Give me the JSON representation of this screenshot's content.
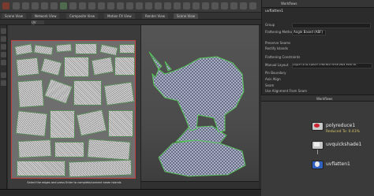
{
  "window_title": "Workflows",
  "tabs": [
    {
      "label": "Scene View"
    },
    {
      "label": "Network View"
    },
    {
      "label": "Composite View"
    },
    {
      "label": "Motion FX View"
    },
    {
      "label": "Render View"
    },
    {
      "label": "Scene View"
    }
  ],
  "uv_view": {
    "title": "UV View",
    "hint": "Select the edges and press Enter to complete/connect seam islands"
  },
  "right_panel": {
    "header": "Workflows",
    "node_title": "uvflatten1",
    "rows": [
      {
        "label": "Group"
      },
      {
        "label": "Flattening Method",
        "value": "Angle Based (ABF)"
      },
      {
        "label": "Preserve Seams"
      },
      {
        "label": "Rectify Islands"
      },
      {
        "label": "Flattening Constraints"
      },
      {
        "label": "Manual Layout",
        "value": "edge17-2cde 1e0b27 1789 8417 8718 2824 3526 18.."
      },
      {
        "label": "Pin Boundary"
      },
      {
        "label": "Axis Align"
      },
      {
        "label": "Seam"
      },
      {
        "label": "Use Alignment From Seam"
      }
    ]
  },
  "network": {
    "path": "Workflows",
    "nodes": [
      {
        "name": "polyreduce1",
        "sub": "Reduced To: 0.43%"
      },
      {
        "name": "uvquickshade1",
        "sub": ""
      },
      {
        "name": "uvflatten1",
        "sub": ""
      }
    ]
  },
  "colors": {
    "node_accent": "#d02030",
    "node_flag_blue": "#3060c0",
    "sub_text": "#d8c76a",
    "uv_border": "#c04040"
  }
}
